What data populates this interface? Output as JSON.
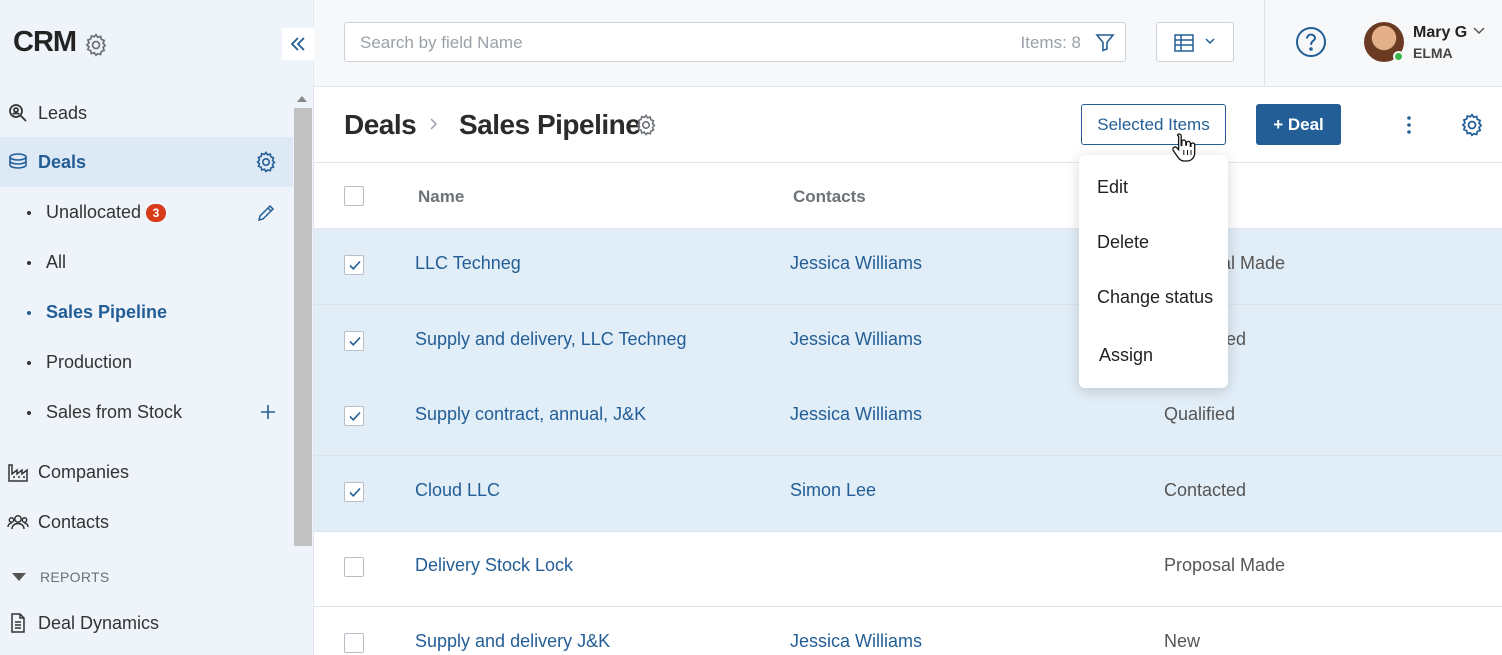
{
  "sidebar": {
    "title": "CRM",
    "items": [
      {
        "label": "Leads"
      },
      {
        "label": "Deals"
      },
      {
        "label": "Companies"
      },
      {
        "label": "Contacts"
      }
    ],
    "sub_items": [
      {
        "label": "Unallocated",
        "badge": "3"
      },
      {
        "label": "All"
      },
      {
        "label": "Sales Pipeline"
      },
      {
        "label": "Production"
      },
      {
        "label": "Sales from Stock"
      }
    ],
    "reports_label": "REPORTS",
    "reports": [
      {
        "label": "Deal Dynamics"
      }
    ]
  },
  "topbar": {
    "search_placeholder": "Search by field Name",
    "items_count": "Items: 8",
    "user_name": "Mary G",
    "user_org": "ELMA"
  },
  "header": {
    "breadcrumb_root": "Deals",
    "breadcrumb_current": "Sales Pipeline",
    "selected_items_label": "Selected Items",
    "add_deal_label": "+ Deal"
  },
  "menu": {
    "items": [
      "Edit",
      "Delete",
      "Change status",
      "Assign"
    ]
  },
  "table": {
    "columns": [
      "Name",
      "Contacts"
    ],
    "rows": [
      {
        "name": "LLC Techneg",
        "contact": "Jessica Williams",
        "status": "Proposal Made",
        "checked": true
      },
      {
        "name": "Supply and delivery, LLC Techneg",
        "contact": "Jessica Williams",
        "status": "Contacted",
        "checked": true
      },
      {
        "name": "Supply contract, annual, J&K",
        "contact": "Jessica Williams",
        "status": "Qualified",
        "checked": true
      },
      {
        "name": "Cloud LLC",
        "contact": "Simon Lee",
        "status": "Contacted",
        "checked": true
      },
      {
        "name": "Delivery Stock Lock",
        "contact": "",
        "status": "Proposal Made",
        "checked": false
      },
      {
        "name": "Supply and delivery J&K",
        "contact": "Jessica Williams",
        "status": "New",
        "checked": false
      }
    ]
  },
  "colors": {
    "accent": "#235e96",
    "sidebar_bg": "#eef4fa",
    "selected_row": "#e1edf7",
    "badge": "#d93a1a"
  }
}
